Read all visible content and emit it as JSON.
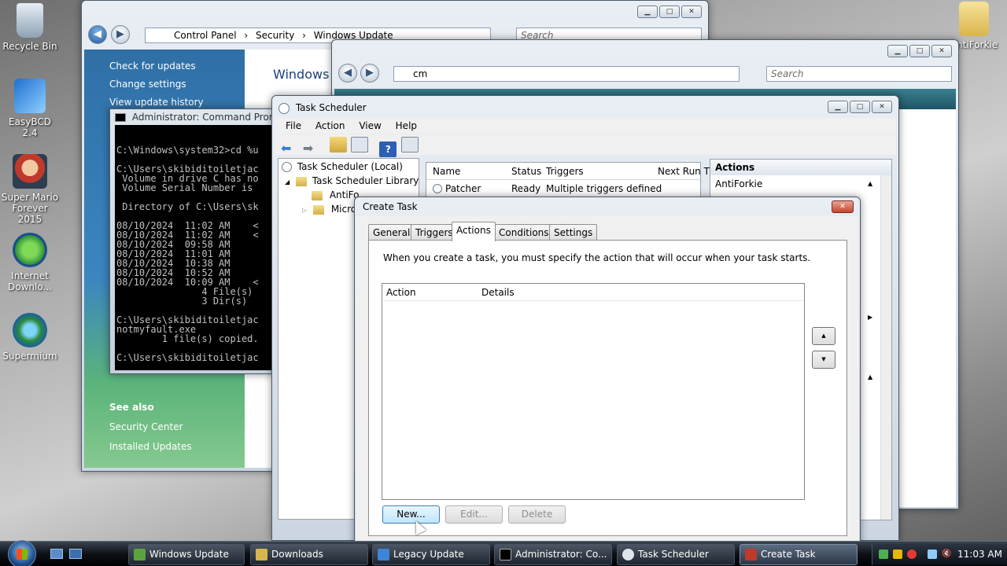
{
  "desktop": {
    "icons": [
      {
        "label": "Recycle Bin"
      },
      {
        "label": "EasyBCD 2.4"
      },
      {
        "label": "Super Mario Forever 2015"
      },
      {
        "label": "Internet Downlo..."
      },
      {
        "label": "Supermium"
      },
      {
        "label": "AntiForkie"
      }
    ]
  },
  "windows_update": {
    "breadcrumb": [
      "Control Panel",
      "Security",
      "Windows Update"
    ],
    "search_placeholder": "Search",
    "heading": "Windows U",
    "side_links": [
      "Check for updates",
      "Change settings",
      "View update history"
    ],
    "see_also": "See also",
    "see_also_links": [
      "Security Center",
      "Installed Updates"
    ]
  },
  "explorer": {
    "address": "cm",
    "search_placeholder": "Search"
  },
  "cmd": {
    "title": "Administrator: Command Prompt",
    "lines": [
      "C:\\Windows\\system32>cd %u",
      "",
      "C:\\Users\\skibiditoiletjac",
      " Volume in drive C has no",
      " Volume Serial Number is",
      "",
      " Directory of C:\\Users\\sk",
      "",
      "08/10/2024  11:02 AM    <",
      "08/10/2024  11:02 AM    <",
      "08/10/2024  09:58 AM",
      "08/10/2024  11:01 AM",
      "08/10/2024  10:38 AM",
      "08/10/2024  10:52 AM",
      "08/10/2024  10:09 AM    <",
      "               4 File(s)",
      "               3 Dir(s)",
      "",
      "C:\\Users\\skibiditoiletjac",
      "notmyfault.exe",
      "        1 file(s) copied.",
      "",
      "C:\\Users\\skibiditoiletjac"
    ]
  },
  "task_scheduler": {
    "title": "Task Scheduler",
    "menu": [
      "File",
      "Action",
      "View",
      "Help"
    ],
    "tree": {
      "root": "Task Scheduler (Local)",
      "library": "Task Scheduler Library",
      "children": [
        "AntiFo",
        "Micros"
      ]
    },
    "columns": [
      "Name",
      "Status",
      "Triggers",
      "Next Run T"
    ],
    "rows": [
      {
        "name": "Patcher",
        "status": "Ready",
        "triggers": "Multiple triggers defined"
      }
    ],
    "actions_header": "Actions",
    "actions_item": "AntiForkie"
  },
  "create_task": {
    "title": "Create Task",
    "tabs": [
      "General",
      "Triggers",
      "Actions",
      "Conditions",
      "Settings"
    ],
    "active_tab": "Actions",
    "description": "When you create a task, you must specify the action that will occur when your task starts.",
    "columns": [
      "Action",
      "Details"
    ],
    "buttons": {
      "new": "New...",
      "edit": "Edit...",
      "delete": "Delete"
    },
    "up_glyph": "▲",
    "down_glyph": "▼"
  },
  "taskbar": {
    "items": [
      "Windows Update",
      "Downloads",
      "Legacy Update",
      "Administrator: Co...",
      "Task Scheduler",
      "Create Task"
    ],
    "clock": "11:03 AM"
  },
  "colors": {
    "accent_blue": "#2b5d9b",
    "wu_sidebar": "#2f6fa6",
    "wu_sidebar_green": "#5bb47a"
  }
}
